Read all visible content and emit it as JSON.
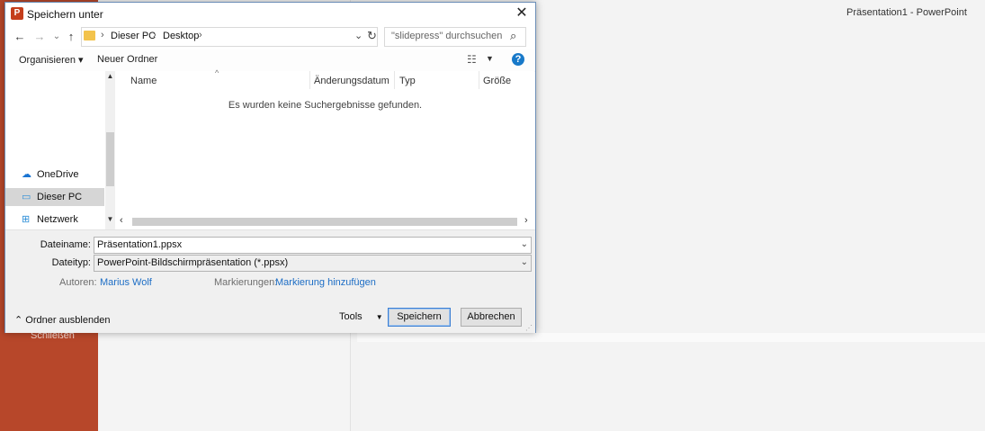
{
  "app": {
    "window_title": "Präsentation1  -  PowerPoint",
    "sidebar_close_label": "Schließen"
  },
  "dialog": {
    "title": "Speichern unter",
    "close_glyph": "✕",
    "nav": {
      "back": "←",
      "forward": "→",
      "recent": "⌄",
      "up": "↑"
    },
    "address": {
      "crumbs": [
        "Dieser PC",
        "Desktop"
      ],
      "sep": "›"
    },
    "search": {
      "placeholder": "\"slidepress\" durchsuchen"
    },
    "toolbar": {
      "organize_label": "Organisieren ▾",
      "new_folder_label": "Neuer Ordner",
      "help_glyph": "?"
    },
    "nav_pane": {
      "items": [
        {
          "label": "OneDrive",
          "icon": "cloud-icon"
        },
        {
          "label": "Dieser PC",
          "icon": "computer-icon",
          "selected": true
        },
        {
          "label": "Netzwerk",
          "icon": "network-icon"
        }
      ]
    },
    "columns": [
      "Name",
      "Änderungsdatum",
      "Typ",
      "Größe"
    ],
    "empty_message": "Es wurden keine Suchergebnisse gefunden.",
    "form": {
      "filename_label": "Dateiname:",
      "filename_value": "Präsentation1.ppsx",
      "filetype_label": "Dateityp:",
      "filetype_value": "PowerPoint-Bildschirmpräsentation (*.ppsx)",
      "authors_label": "Autoren:",
      "authors_value": "Marius Wolf",
      "tags_label": "Markierungen:",
      "tags_value": "Markierung hinzufügen"
    },
    "footer": {
      "hide_folders_label": "Ordner ausblenden",
      "tools_label": "Tools",
      "save_label": "Speichern",
      "cancel_label": "Abbrechen"
    }
  },
  "colors": {
    "accent": "#b7472a",
    "link": "#1c6dc5",
    "help": "#1879c9"
  }
}
